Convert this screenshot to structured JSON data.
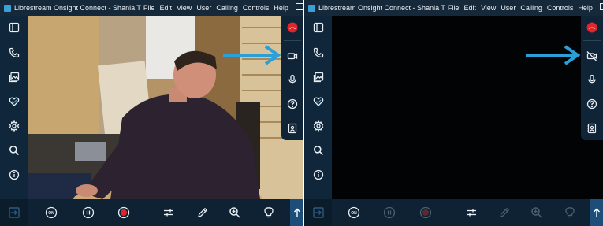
{
  "windows": [
    {
      "title": "Librestream Onsight Connect - Shania T",
      "menu": [
        "File",
        "Edit",
        "View",
        "User",
        "Calling",
        "Controls",
        "Help"
      ],
      "video_state": "live",
      "camera_state": "camera-on"
    },
    {
      "title": "Librestream Onsight Connect - Shania T",
      "menu": [
        "File",
        "Edit",
        "View",
        "User",
        "Calling",
        "Controls",
        "Help"
      ],
      "video_state": "black",
      "camera_state": "camera-off"
    }
  ],
  "window_controls": [
    "restore-icon",
    "maximize-diagonal-icon",
    "close-icon"
  ],
  "left_sidebar_icons": [
    "panel-icon",
    "phone-icon",
    "gallery-icon",
    "favorites-icon",
    "settings-icon",
    "search-icon",
    "info-icon"
  ],
  "right_panel_icons": [
    "end-call-icon",
    "camera-icon",
    "microphone-icon",
    "help-icon",
    "contacts-icon"
  ],
  "bottom_toolbar_icons": [
    "exit-icon",
    "on-toggle-icon",
    "pause-icon",
    "record-icon",
    "adjust-icon",
    "pen-icon",
    "zoom-icon",
    "light-icon",
    "up-arrow-icon"
  ],
  "on_label": "ON",
  "colors": {
    "titlebar": "#15293a",
    "sidebar": "#10263a",
    "end_call": "#e0262b",
    "record": "#e0262b",
    "annotation_arrow": "#2a9fd8",
    "up_arrow_bg": "#1d4e7a"
  }
}
